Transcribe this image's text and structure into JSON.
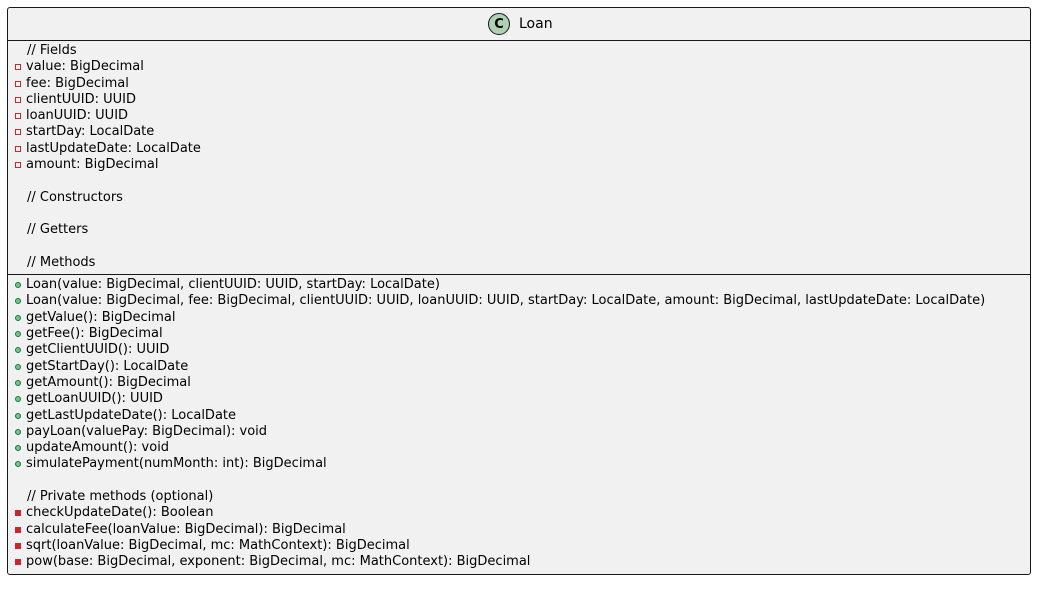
{
  "class": {
    "icon_letter": "C",
    "name": "Loan"
  },
  "colors": {
    "box_fill": "#f1f1f1",
    "border": "#181818",
    "class_icon": "#add1b2",
    "private_marker": "#c82930",
    "public_marker": "#84be84"
  },
  "fields_section": [
    {
      "kind": "comment",
      "text": "// Fields"
    },
    {
      "kind": "member",
      "visibility": "private",
      "text": "value: BigDecimal"
    },
    {
      "kind": "member",
      "visibility": "private",
      "text": "fee: BigDecimal"
    },
    {
      "kind": "member",
      "visibility": "private",
      "text": "clientUUID: UUID"
    },
    {
      "kind": "member",
      "visibility": "private",
      "text": "loanUUID: UUID"
    },
    {
      "kind": "member",
      "visibility": "private",
      "text": "startDay: LocalDate"
    },
    {
      "kind": "member",
      "visibility": "private",
      "text": "lastUpdateDate: LocalDate"
    },
    {
      "kind": "member",
      "visibility": "private",
      "text": "amount: BigDecimal"
    },
    {
      "kind": "blank",
      "text": ""
    },
    {
      "kind": "comment",
      "text": "// Constructors"
    },
    {
      "kind": "blank",
      "text": ""
    },
    {
      "kind": "comment",
      "text": "// Getters"
    },
    {
      "kind": "blank",
      "text": ""
    },
    {
      "kind": "comment",
      "text": "// Methods"
    }
  ],
  "methods_section": [
    {
      "kind": "member",
      "visibility": "public",
      "text": "Loan(value: BigDecimal, clientUUID: UUID, startDay: LocalDate)"
    },
    {
      "kind": "member",
      "visibility": "public",
      "text": "Loan(value: BigDecimal, fee: BigDecimal, clientUUID: UUID, loanUUID: UUID, startDay: LocalDate, amount: BigDecimal, lastUpdateDate: LocalDate)"
    },
    {
      "kind": "member",
      "visibility": "public",
      "text": "getValue(): BigDecimal"
    },
    {
      "kind": "member",
      "visibility": "public",
      "text": "getFee(): BigDecimal"
    },
    {
      "kind": "member",
      "visibility": "public",
      "text": "getClientUUID(): UUID"
    },
    {
      "kind": "member",
      "visibility": "public",
      "text": "getStartDay(): LocalDate"
    },
    {
      "kind": "member",
      "visibility": "public",
      "text": "getAmount(): BigDecimal"
    },
    {
      "kind": "member",
      "visibility": "public",
      "text": "getLoanUUID(): UUID"
    },
    {
      "kind": "member",
      "visibility": "public",
      "text": "getLastUpdateDate(): LocalDate"
    },
    {
      "kind": "member",
      "visibility": "public",
      "text": "payLoan(valuePay: BigDecimal): void"
    },
    {
      "kind": "member",
      "visibility": "public",
      "text": "updateAmount(): void"
    },
    {
      "kind": "member",
      "visibility": "public",
      "text": "simulatePayment(numMonth: int): BigDecimal"
    },
    {
      "kind": "blank",
      "text": ""
    },
    {
      "kind": "comment",
      "text": "// Private methods (optional)"
    },
    {
      "kind": "member",
      "visibility": "private-method",
      "text": "checkUpdateDate(): Boolean"
    },
    {
      "kind": "member",
      "visibility": "private-method",
      "text": "calculateFee(loanValue: BigDecimal): BigDecimal"
    },
    {
      "kind": "member",
      "visibility": "private-method",
      "text": "sqrt(loanValue: BigDecimal, mc: MathContext): BigDecimal"
    },
    {
      "kind": "member",
      "visibility": "private-method",
      "text": "pow(base: BigDecimal, exponent: BigDecimal, mc: MathContext): BigDecimal"
    }
  ]
}
